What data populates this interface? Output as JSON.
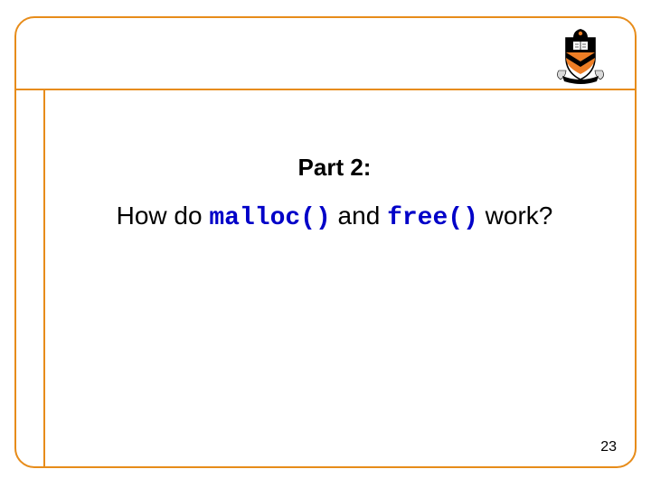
{
  "slide": {
    "part_label": "Part 2:",
    "question_prefix": "How do ",
    "code1": "malloc()",
    "question_mid": " and ",
    "code2": "free()",
    "question_suffix": " work?",
    "page_number": "23"
  },
  "logo": {
    "name": "princeton-shield"
  },
  "colors": {
    "border": "#e78c1a",
    "code": "#0000C8"
  }
}
